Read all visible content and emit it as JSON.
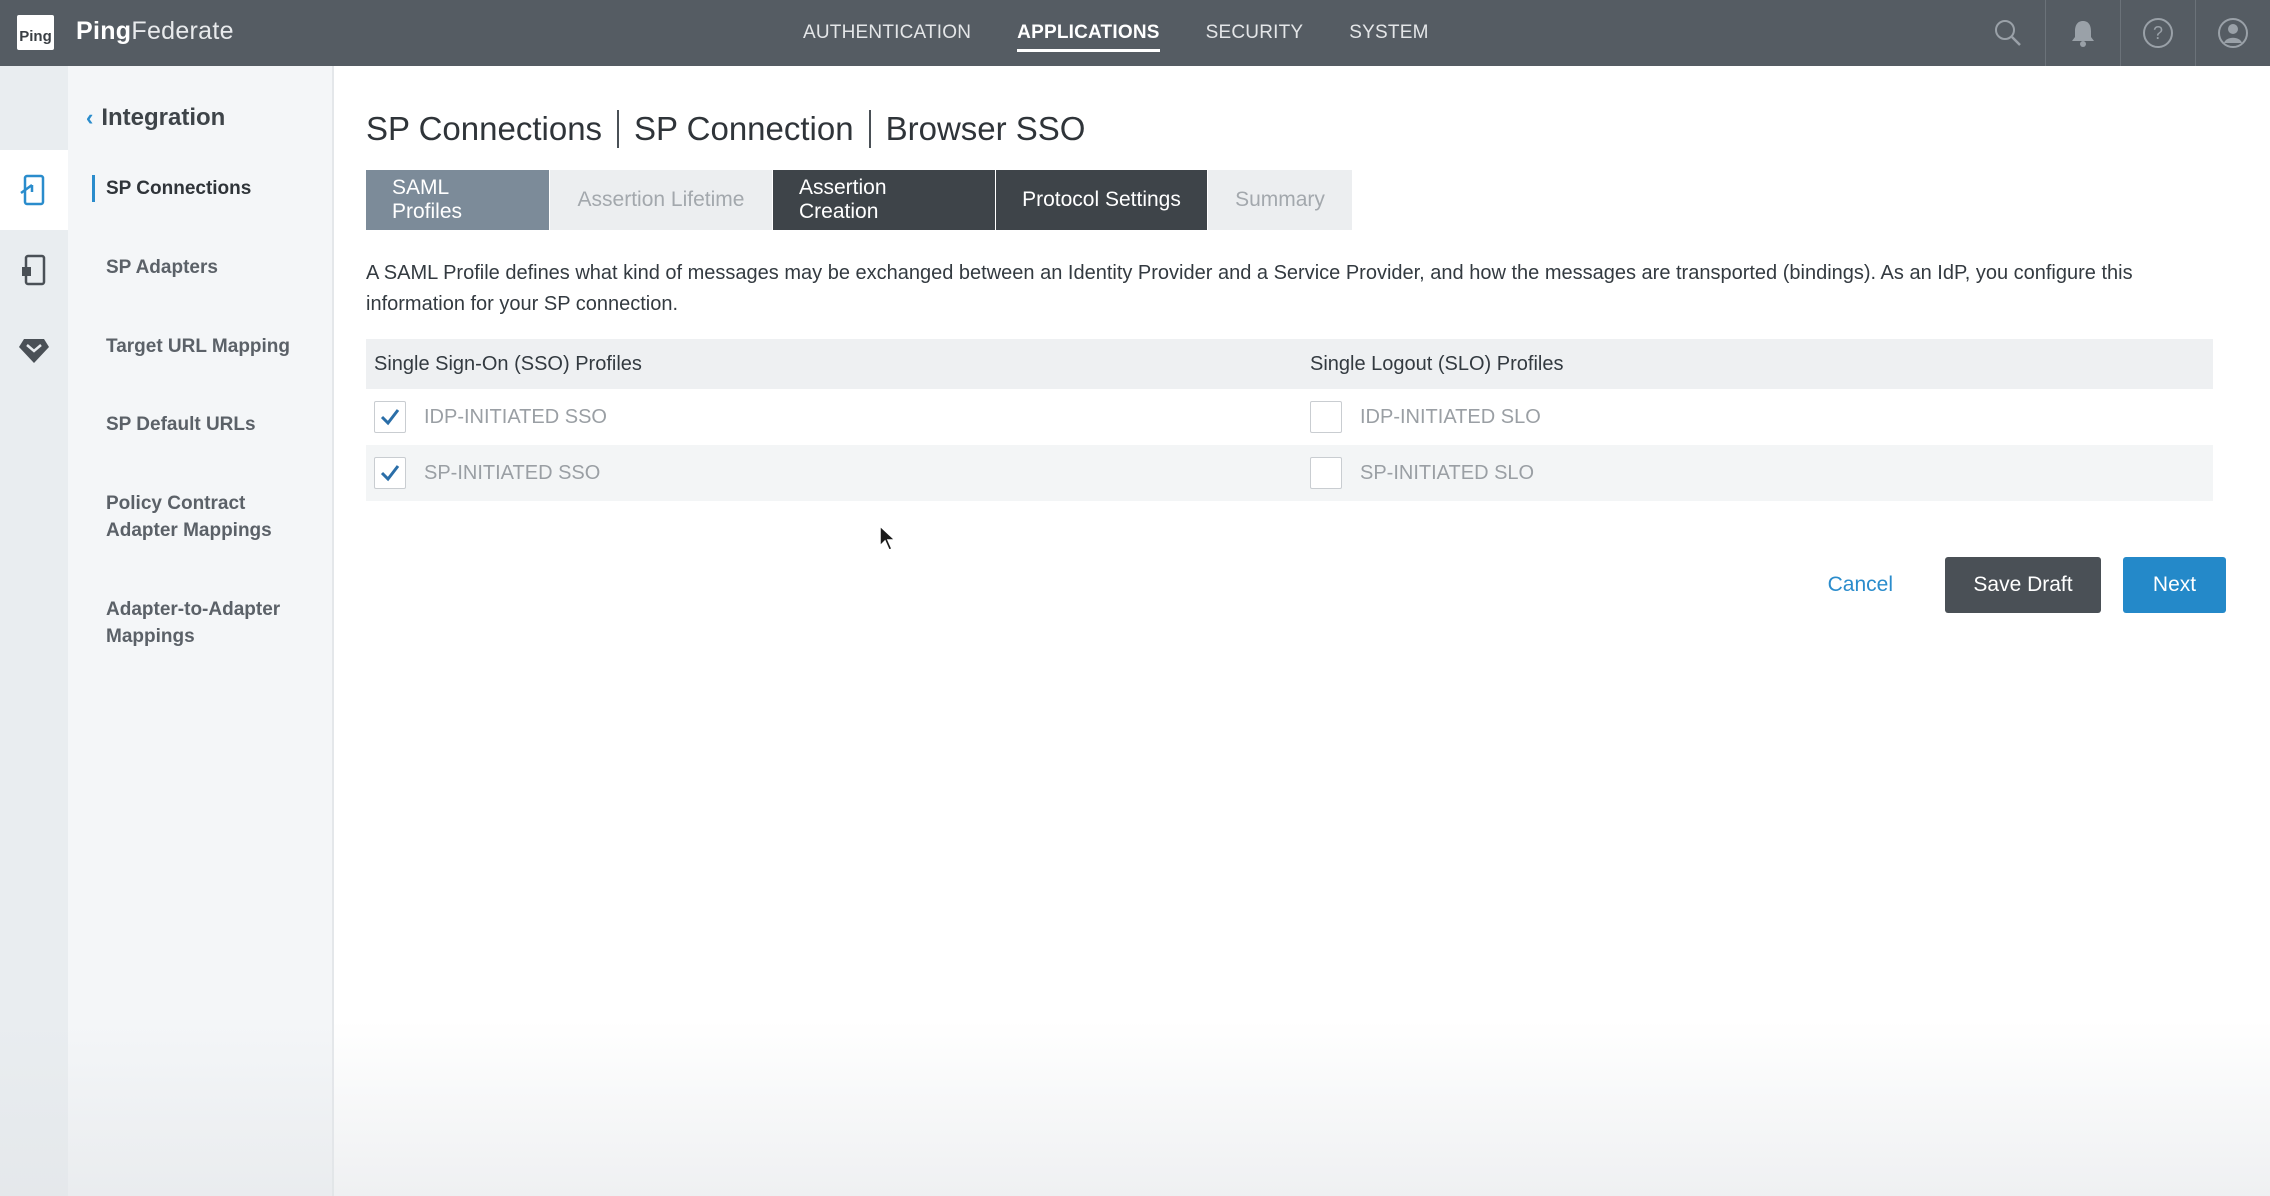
{
  "app": {
    "logo_text": "Ping",
    "brand_bold": "Ping",
    "brand_light": "Federate"
  },
  "topnav": {
    "items": [
      {
        "label": "AUTHENTICATION"
      },
      {
        "label": "APPLICATIONS",
        "active": true
      },
      {
        "label": "SECURITY"
      },
      {
        "label": "SYSTEM"
      }
    ]
  },
  "top_icons": [
    "search-icon",
    "bell-icon",
    "help-icon",
    "user-icon"
  ],
  "rail_icons": [
    "sp-connection-icon",
    "sp-adapter-icon",
    "policy-icon"
  ],
  "sidebar": {
    "back_label": "Integration",
    "items": [
      {
        "label": "SP Connections",
        "active": true
      },
      {
        "label": "SP Adapters"
      },
      {
        "label": "Target URL Mapping"
      },
      {
        "label": "SP Default URLs"
      },
      {
        "label": "Policy Contract Adapter Mappings"
      },
      {
        "label": "Adapter-to-Adapter Mappings"
      }
    ]
  },
  "breadcrumb": [
    "SP Connections",
    "SP Connection",
    "Browser SSO"
  ],
  "tabs": [
    {
      "label": "SAML Profiles",
      "state": "current"
    },
    {
      "label": "Assertion Lifetime",
      "state": "disabled"
    },
    {
      "label": "Assertion Creation",
      "state": "enabled"
    },
    {
      "label": "Protocol Settings",
      "state": "enabled"
    },
    {
      "label": "Summary",
      "state": "disabled"
    }
  ],
  "description": "A SAML Profile defines what kind of messages may be exchanged between an Identity Provider and a Service Provider, and how the messages are transported (bindings). As an IdP, you configure this information for your SP connection.",
  "profiles": {
    "sso_header": "Single Sign-On (SSO) Profiles",
    "slo_header": "Single Logout (SLO) Profiles",
    "sso": [
      {
        "label": "IDP-INITIATED SSO",
        "checked": true
      },
      {
        "label": "SP-INITIATED SSO",
        "checked": true
      }
    ],
    "slo": [
      {
        "label": "IDP-INITIATED SLO",
        "checked": false
      },
      {
        "label": "SP-INITIATED SLO",
        "checked": false
      }
    ]
  },
  "actions": {
    "cancel": "Cancel",
    "save_draft": "Save Draft",
    "next": "Next"
  },
  "colors": {
    "topbar": "#555c63",
    "accent": "#2489c9",
    "tab_current": "#7c8b99",
    "tab_dark": "#3e4449"
  }
}
